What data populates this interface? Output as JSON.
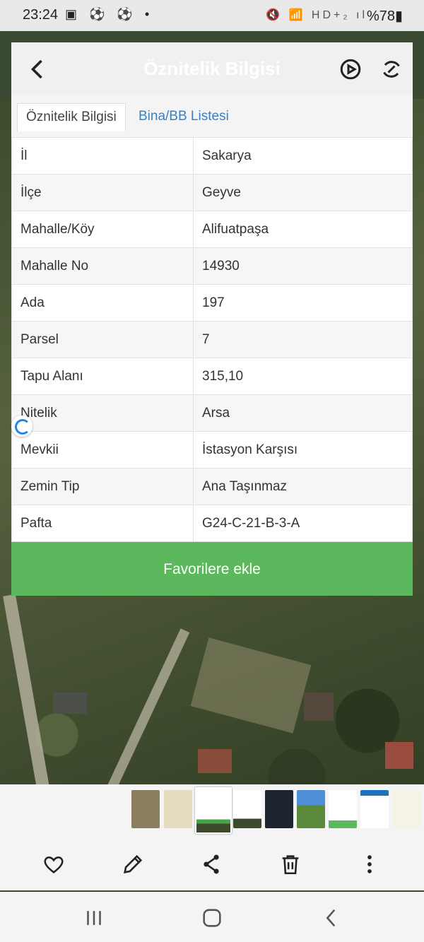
{
  "status": {
    "time": "23:24",
    "left_icons": "▣ ⚽ ⚽ •",
    "right_icons": "🔇 📶 HD+₂ ıl",
    "battery": "%78▮"
  },
  "appbar": {
    "title": "Öznitelik Bilgisi"
  },
  "tabs": [
    {
      "label": "Öznitelik Bilgisi"
    },
    {
      "label": "Bina/BB Listesi"
    }
  ],
  "attributes": [
    {
      "key": "İl",
      "value": "Sakarya"
    },
    {
      "key": "İlçe",
      "value": "Geyve"
    },
    {
      "key": "Mahalle/Köy",
      "value": "Alifuatpaşa"
    },
    {
      "key": "Mahalle No",
      "value": "14930"
    },
    {
      "key": "Ada",
      "value": "197"
    },
    {
      "key": "Parsel",
      "value": "7"
    },
    {
      "key": "Tapu Alanı",
      "value": "315,10"
    },
    {
      "key": "Nitelik",
      "value": "Arsa"
    },
    {
      "key": "Mevkii",
      "value": "İstasyon Karşısı"
    },
    {
      "key": "Zemin Tip",
      "value": "Ana Taşınmaz"
    },
    {
      "key": "Pafta",
      "value": "G24-C-21-B-3-A"
    }
  ],
  "favorite_button": "Favorilere ekle",
  "colors": {
    "accent_green": "#5cb85c",
    "link_blue": "#3b7fc1"
  }
}
